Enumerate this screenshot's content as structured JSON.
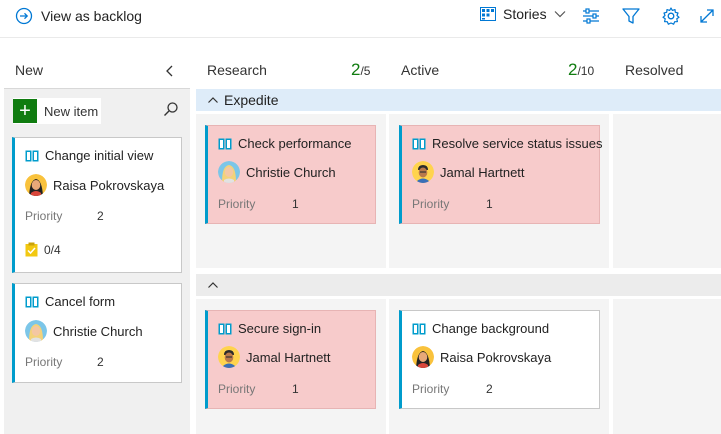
{
  "toolbar": {
    "back_label": "View as backlog",
    "work_item_type": "Stories"
  },
  "columns": {
    "new": {
      "label": "New",
      "new_item_label": "New item"
    },
    "research": {
      "label": "Research",
      "wip_current": "2",
      "wip_limit": "/5"
    },
    "active": {
      "label": "Active",
      "wip_current": "2",
      "wip_limit": "/10"
    },
    "resolved": {
      "label": "Resolved"
    }
  },
  "swimlanes": {
    "expedite": {
      "label": "Expedite"
    },
    "default": {
      "label": ""
    }
  },
  "priority_label": "Priority",
  "cards": {
    "new": [
      {
        "title": "Change initial view",
        "assignee": "Raisa Pokrovskaya",
        "priority": "2",
        "tasks": "0/4",
        "avatar": "raisa"
      },
      {
        "title": "Cancel form",
        "assignee": "Christie Church",
        "priority": "2",
        "avatar": "christie"
      }
    ],
    "expedite_research": {
      "title": "Check performance",
      "assignee": "Christie Church",
      "priority": "1",
      "avatar": "christie"
    },
    "expedite_active": {
      "title": "Resolve service status issues",
      "assignee": "Jamal Hartnett",
      "priority": "1",
      "avatar": "jamal"
    },
    "default_research": {
      "title": "Secure sign-in",
      "assignee": "Jamal Hartnett",
      "priority": "1",
      "avatar": "jamal"
    },
    "default_active": {
      "title": "Change background",
      "assignee": "Raisa Pokrovskaya",
      "priority": "2",
      "avatar": "raisa"
    }
  },
  "colors": {
    "accent": "#0078d4",
    "card_bar": "#009ccc",
    "expedite_card": "#f7cbcb",
    "wip_ok": "#107c10",
    "new_item_button": "#107c10",
    "swimlane_expedite": "#deecf9"
  }
}
